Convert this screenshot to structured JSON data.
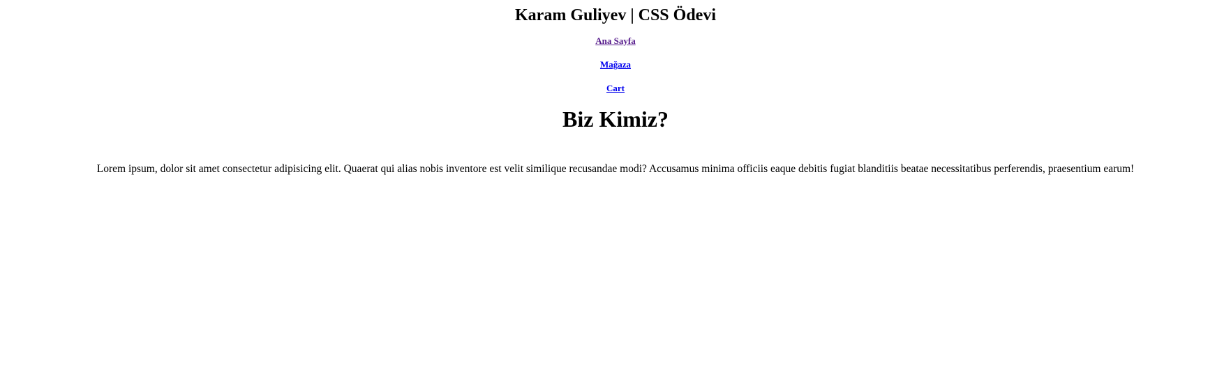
{
  "header": {
    "title": "Karam Guliyev | CSS Ödevi"
  },
  "nav": {
    "items": [
      {
        "label": "Ana Sayfa",
        "state": "visited"
      },
      {
        "label": "Mağaza",
        "state": "link"
      },
      {
        "label": "Cart",
        "state": "link"
      }
    ]
  },
  "main": {
    "heading": "Biz Kimiz?",
    "paragraph": "Lorem ipsum, dolor sit amet consectetur adipisicing elit. Quaerat qui alias nobis inventore est velit similique recusandae modi? Accusamus minima officiis eaque debitis fugiat blanditiis beatae necessitatibus perferendis, praesentium earum!"
  },
  "colors": {
    "link": "#0000ee",
    "visited_link": "#551a8b",
    "text": "#000000",
    "background": "#ffffff"
  }
}
